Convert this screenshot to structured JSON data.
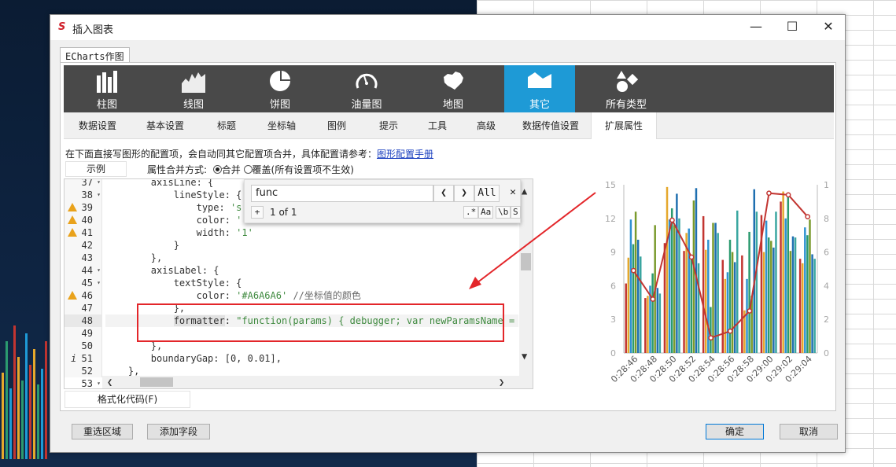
{
  "dialog": {
    "title": "插入图表",
    "app_icon_text": "S",
    "main_tab": "ECharts作图"
  },
  "chart_types": [
    {
      "label": "柱图",
      "icon": "bar-chart-icon"
    },
    {
      "label": "线图",
      "icon": "line-chart-icon"
    },
    {
      "label": "饼图",
      "icon": "pie-chart-icon"
    },
    {
      "label": "油量图",
      "icon": "gauge-icon"
    },
    {
      "label": "地图",
      "icon": "map-icon"
    },
    {
      "label": "其它",
      "icon": "other-chart-icon",
      "active": true
    },
    {
      "label": "所有类型",
      "icon": "all-types-icon"
    }
  ],
  "sub_tabs": [
    "数据设置",
    "基本设置",
    "标题",
    "坐标轴",
    "图例",
    "提示",
    "工具",
    "高级",
    "数据传值设置",
    "扩展属性"
  ],
  "active_sub_tab": "扩展属性",
  "description": "在下面直接写图形的配置项，会自动同其它配置项合并，具体配置请参考：",
  "description_link": "图形配置手册",
  "example_button": "示例",
  "merge_label": "属性合并方式:",
  "merge_option_merge": "合并",
  "merge_option_override": "覆盖(所有设置项不生效)",
  "find": {
    "query": "func",
    "count": "1 of 1",
    "all_label": "All",
    "prev": "❮",
    "next": "❯",
    "close": "✕",
    "toggle": "+",
    "opt_regex": ".*",
    "opt_case": "Aa",
    "opt_word": "\\b",
    "opt_sel": "S"
  },
  "editor": {
    "lines": [
      {
        "n": "37",
        "fold": "▾",
        "mark": "",
        "code": "        axisLine: {"
      },
      {
        "n": "38",
        "fold": "▾",
        "mark": "",
        "code": "            lineStyle: {"
      },
      {
        "n": "39",
        "fold": "",
        "mark": "warn",
        "code": "                type: 's"
      },
      {
        "n": "40",
        "fold": "",
        "mark": "warn",
        "code": "                color: '"
      },
      {
        "n": "41",
        "fold": "",
        "mark": "warn",
        "code": "                width: '1'"
      },
      {
        "n": "42",
        "fold": "",
        "mark": "",
        "code": "            }"
      },
      {
        "n": "43",
        "fold": "",
        "mark": "",
        "code": "        },"
      },
      {
        "n": "44",
        "fold": "▾",
        "mark": "",
        "code": "        axisLabel: {"
      },
      {
        "n": "45",
        "fold": "▾",
        "mark": "",
        "code": "            textStyle: {"
      },
      {
        "n": "46",
        "fold": "",
        "mark": "warn",
        "code": "                color: '#A6A6A6' //坐标值的颜色"
      },
      {
        "n": "47",
        "fold": "",
        "mark": "",
        "code": "            },"
      },
      {
        "n": "48",
        "fold": "",
        "mark": "",
        "code": "            formatter: \"function(params) { debugger; var newParamsName = '"
      },
      {
        "n": "49",
        "fold": "",
        "mark": "",
        "code": ""
      },
      {
        "n": "50",
        "fold": "",
        "mark": "",
        "code": "        },"
      },
      {
        "n": "51",
        "fold": "",
        "mark": "info",
        "code": "        boundaryGap: [0, 0.01],"
      },
      {
        "n": "52",
        "fold": "",
        "mark": "",
        "code": "    },"
      },
      {
        "n": "53",
        "fold": "▾",
        "mark": "",
        "code": "    {"
      }
    ]
  },
  "format_button": "格式化代码(F)",
  "footer": {
    "reselect": "重选区域",
    "add_field": "添加字段",
    "ok": "确定",
    "cancel": "取消"
  },
  "chart_data": {
    "type": "bar",
    "categories": [
      "0:28:46",
      "0:28:48",
      "0:28:50",
      "0:28:52",
      "0:28:54",
      "0:28:56",
      "0:28:58",
      "0:29:00",
      "0:29:02",
      "0:29:04"
    ],
    "y_left": {
      "ticks": [
        "0",
        "3",
        "6",
        "9",
        "12",
        "15"
      ],
      "ylim": [
        0,
        15
      ]
    },
    "y_right": {
      "ticks": [
        "0",
        "2",
        "4",
        "6",
        "8",
        "1"
      ],
      "ylim": [
        0,
        10
      ]
    },
    "bar_colors": [
      "#c23531",
      "#e5a82c",
      "#2f92d1",
      "#2b9a6f",
      "#7a9a2c",
      "#1f6fb0",
      "#3aa6a0"
    ],
    "series": [
      {
        "values": [
          6.2,
          4.9,
          9.8,
          9.1,
          12.2,
          8.3,
          8.7,
          12.3,
          13.5,
          8.4
        ]
      },
      {
        "values": [
          8.5,
          5.1,
          14.8,
          10.7,
          9.2,
          6.6,
          3.8,
          9.0,
          14.4,
          8.0
        ]
      },
      {
        "values": [
          11.9,
          6.0,
          11.9,
          11.1,
          10.1,
          7.2,
          6.6,
          11.8,
          12.0,
          11.2
        ]
      },
      {
        "values": [
          9.7,
          7.1,
          12.9,
          8.6,
          4.1,
          10.1,
          10.8,
          10.3,
          14.0,
          10.5
        ]
      },
      {
        "values": [
          12.6,
          11.4,
          11.4,
          13.6,
          11.6,
          9.0,
          5.1,
          10.0,
          9.1,
          11.9
        ]
      },
      {
        "values": [
          10.1,
          5.8,
          14.2,
          14.7,
          11.6,
          8.1,
          14.6,
          9.4,
          10.4,
          8.8
        ]
      },
      {
        "values": [
          8.6,
          5.3,
          12.0,
          8.0,
          10.7,
          12.7,
          12.6,
          12.6,
          10.3,
          8.4
        ]
      }
    ],
    "line": {
      "values": [
        4.9,
        3.2,
        7.9,
        5.7,
        0.9,
        1.3,
        2.5,
        9.5,
        9.4,
        8.1
      ],
      "color": "#c23531"
    }
  }
}
